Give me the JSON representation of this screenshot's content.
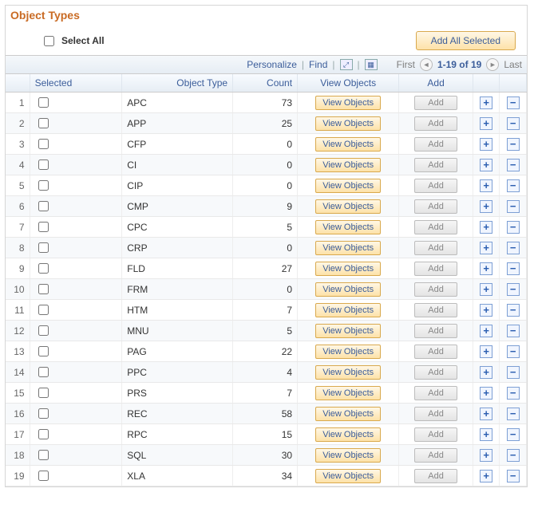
{
  "title": "Object Types",
  "select_all_label": "Select All",
  "add_all_selected_label": "Add All Selected",
  "toolbar": {
    "personalize": "Personalize",
    "find": "Find",
    "first": "First",
    "last": "Last",
    "range": "1-19 of 19"
  },
  "columns": {
    "selected": "Selected",
    "object_type": "Object Type",
    "count": "Count",
    "view_objects": "View Objects",
    "add": "Add"
  },
  "buttons": {
    "view_objects": "View Objects",
    "add": "Add"
  },
  "rows": [
    {
      "n": 1,
      "object_type": "APC",
      "count": 73
    },
    {
      "n": 2,
      "object_type": "APP",
      "count": 25
    },
    {
      "n": 3,
      "object_type": "CFP",
      "count": 0
    },
    {
      "n": 4,
      "object_type": "CI",
      "count": 0
    },
    {
      "n": 5,
      "object_type": "CIP",
      "count": 0
    },
    {
      "n": 6,
      "object_type": "CMP",
      "count": 9
    },
    {
      "n": 7,
      "object_type": "CPC",
      "count": 5
    },
    {
      "n": 8,
      "object_type": "CRP",
      "count": 0
    },
    {
      "n": 9,
      "object_type": "FLD",
      "count": 27
    },
    {
      "n": 10,
      "object_type": "FRM",
      "count": 0
    },
    {
      "n": 11,
      "object_type": "HTM",
      "count": 7
    },
    {
      "n": 12,
      "object_type": "MNU",
      "count": 5
    },
    {
      "n": 13,
      "object_type": "PAG",
      "count": 22
    },
    {
      "n": 14,
      "object_type": "PPC",
      "count": 4
    },
    {
      "n": 15,
      "object_type": "PRS",
      "count": 7
    },
    {
      "n": 16,
      "object_type": "REC",
      "count": 58
    },
    {
      "n": 17,
      "object_type": "RPC",
      "count": 15
    },
    {
      "n": 18,
      "object_type": "SQL",
      "count": 30
    },
    {
      "n": 19,
      "object_type": "XLA",
      "count": 34
    }
  ]
}
